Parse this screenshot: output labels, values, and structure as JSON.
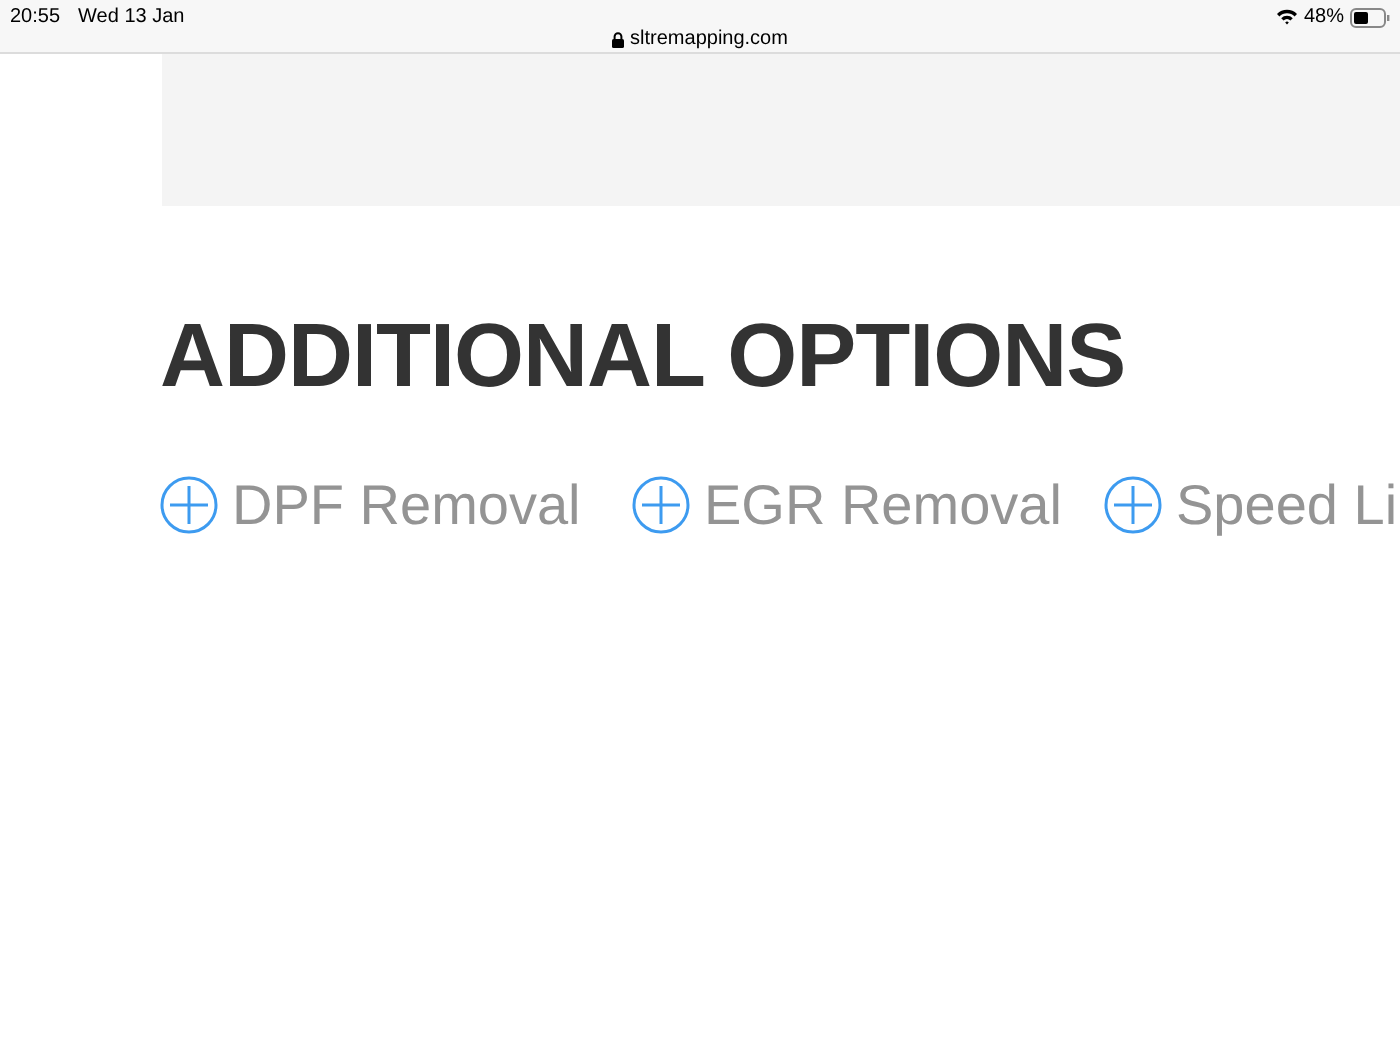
{
  "status_bar": {
    "time": "20:55",
    "date": "Wed 13 Jan",
    "url": "sltremapping.com",
    "battery": "48%"
  },
  "heading": "ADDITIONAL OPTIONS",
  "options": [
    {
      "label": "DPF Removal"
    },
    {
      "label": "EGR Removal"
    },
    {
      "label": "Speed Li"
    }
  ]
}
